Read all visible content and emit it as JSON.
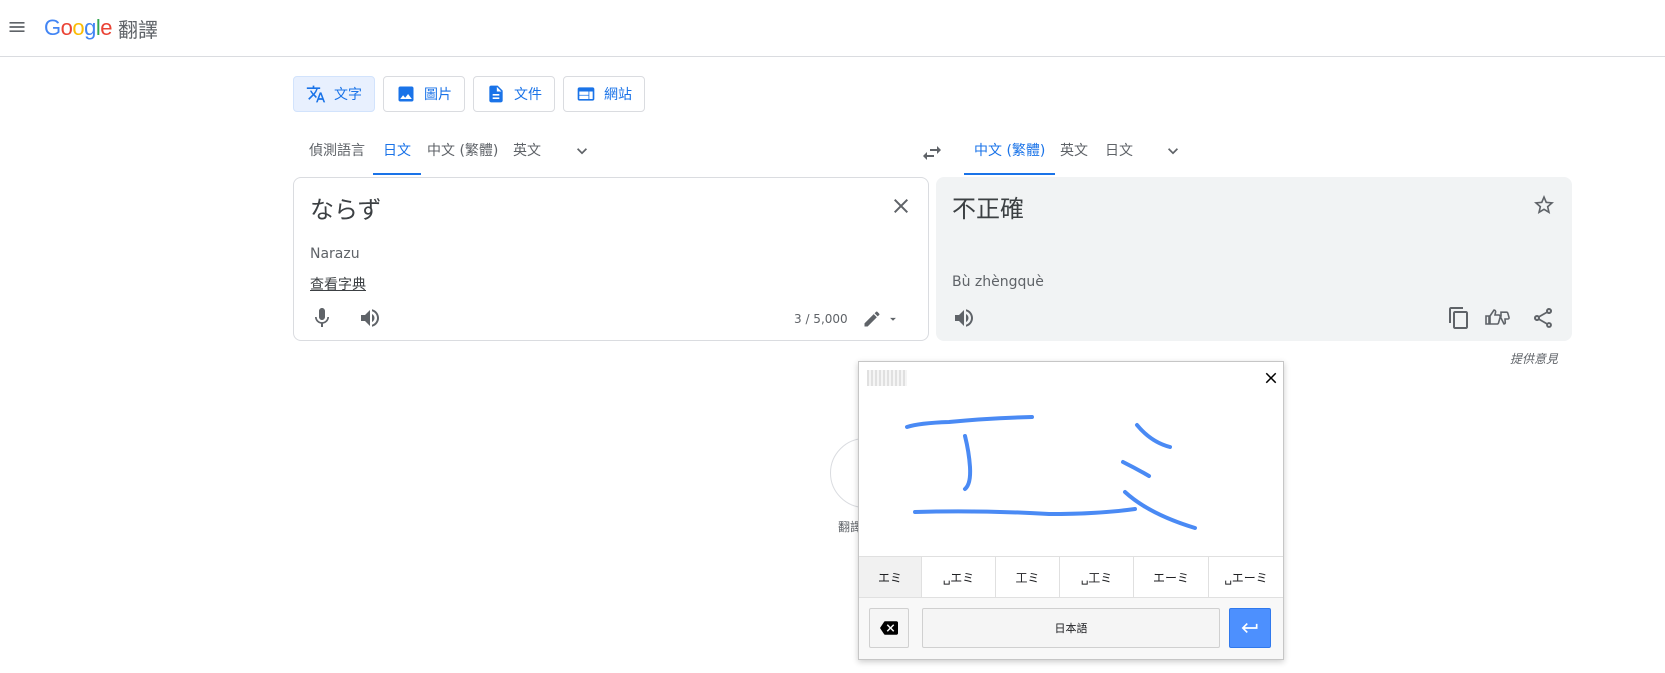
{
  "header": {
    "logo_word": [
      "G",
      "o",
      "o",
      "g",
      "l",
      "e"
    ],
    "product": "翻譯"
  },
  "modes": [
    {
      "label": "文字",
      "icon": "translate-icon",
      "active": true
    },
    {
      "label": "圖片",
      "icon": "image-icon",
      "active": false
    },
    {
      "label": "文件",
      "icon": "document-icon",
      "active": false
    },
    {
      "label": "網站",
      "icon": "website-icon",
      "active": false
    }
  ],
  "source_langs": [
    "偵測語言",
    "日文",
    "中文 (繁體)",
    "英文"
  ],
  "source_lang_active": "日文",
  "target_langs": [
    "中文 (繁體)",
    "英文",
    "日文"
  ],
  "target_lang_active": "中文 (繁體)",
  "source": {
    "text": "ならず",
    "romanization": "Narazu",
    "dictionary_link": "查看字典",
    "char_count": "3 / 5,000"
  },
  "target": {
    "text": "不正確",
    "romanization": "Bù zhèngquè"
  },
  "feedback": "提供意見",
  "history_label": "翻譯",
  "handwriting": {
    "strokes_text": "エミ",
    "candidates": [
      "エミ",
      "␣エミ",
      "工ミ",
      "␣工ミ",
      "エーミ",
      "␣エーミ"
    ],
    "selected_candidate": "エミ",
    "language": "日本語"
  },
  "colors": {
    "accent": "#1a73e8",
    "ink": "#4a8af4",
    "enter": "#4d90fe"
  }
}
